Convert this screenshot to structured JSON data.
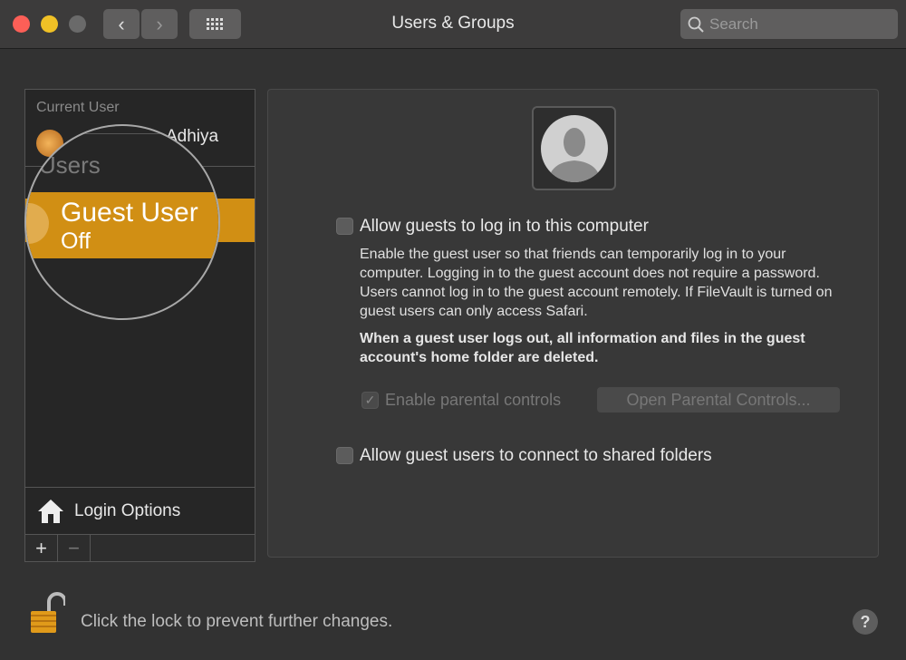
{
  "window": {
    "title": "Users & Groups",
    "search_placeholder": "Search"
  },
  "toolbar": {
    "back": "‹",
    "forward": "›",
    "grid": "⋮⋮⋮"
  },
  "sidebar": {
    "current_user_header": "Current User",
    "current_user_name": "Adhiya",
    "other_users_header": "r Users",
    "guest_name": "Guest User",
    "guest_status": "Off",
    "login_options": "Login Options",
    "add": "+",
    "remove": "−"
  },
  "main": {
    "allow_guests": "Allow guests to log in to this computer",
    "allow_guests_checked": false,
    "description": "Enable the guest user so that friends can temporarily log in to your computer. Logging in to the guest account does not require a password. Users cannot log in to the guest account remotely. If FileVault is turned on guest users can only access Safari.",
    "warning": "When a guest user logs out, all information and files in the guest account's home folder are deleted.",
    "parental": "Enable parental controls",
    "parental_checked": true,
    "open_parental": "Open Parental Controls...",
    "shared_folders": "Allow guest users to connect to shared folders",
    "shared_folders_checked": false
  },
  "footer": {
    "lock_text": "Click the lock to prevent further changes.",
    "help": "?"
  },
  "colors": {
    "accent": "#d18f14",
    "close": "#fc5f57",
    "minimize": "#f0c126"
  }
}
